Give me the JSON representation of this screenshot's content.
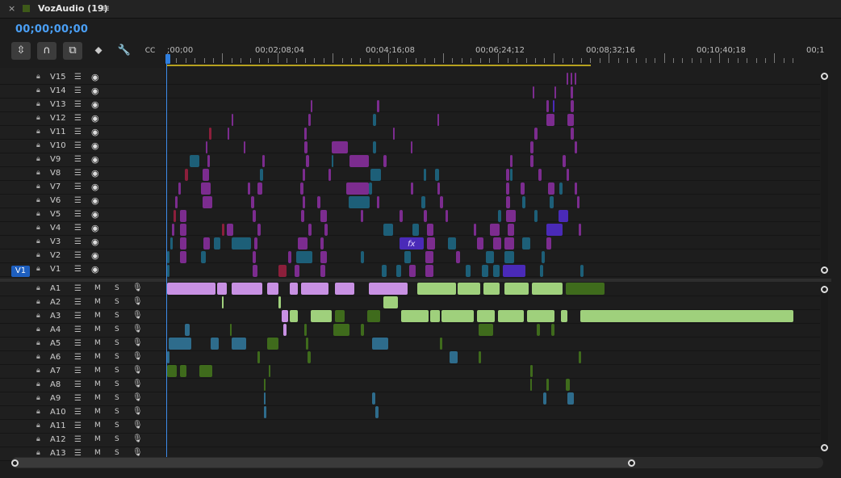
{
  "tab": {
    "close": "×",
    "title": "VozAudio (19)",
    "menu": "≡",
    "swatch_color": "#3e5a19"
  },
  "timecode": "00;00;00;00",
  "tools": [
    {
      "name": "insert-edit-icon",
      "glyph": "⇳"
    },
    {
      "name": "snap-magnet-icon",
      "glyph": "∩"
    },
    {
      "name": "linked-selection-icon",
      "glyph": "⧉"
    },
    {
      "name": "add-marker-icon",
      "glyph": "⬥"
    },
    {
      "name": "wrench-settings-icon",
      "glyph": "🔧"
    },
    {
      "name": "captions-icon",
      "glyph": "CC"
    }
  ],
  "ruler": {
    "labels": [
      ";00;00",
      "00;02;08;04",
      "00;04;16;08",
      "00;06;24;12",
      "00;08;32;16",
      "00;10;40;18",
      "00;1"
    ]
  },
  "video_tracks": [
    "V15",
    "V14",
    "V13",
    "V12",
    "V11",
    "V10",
    "V9",
    "V8",
    "V7",
    "V6",
    "V5",
    "V4",
    "V3",
    "V2",
    "V1"
  ],
  "audio_tracks": [
    "A1",
    "A2",
    "A3",
    "A4",
    "A5",
    "A6",
    "A7",
    "A8",
    "A9",
    "A10",
    "A11",
    "A12",
    "A13"
  ],
  "audio_buttons": {
    "mute": "M",
    "solo": "S"
  },
  "v1_target": "V1",
  "fx_badge": "fx",
  "colors": {
    "accent_blue": "#4a9ff5",
    "purple": "#7c2c8f",
    "teal": "#1d5f78",
    "green": "#3f6b1c",
    "work_area": "#b6a11f"
  }
}
